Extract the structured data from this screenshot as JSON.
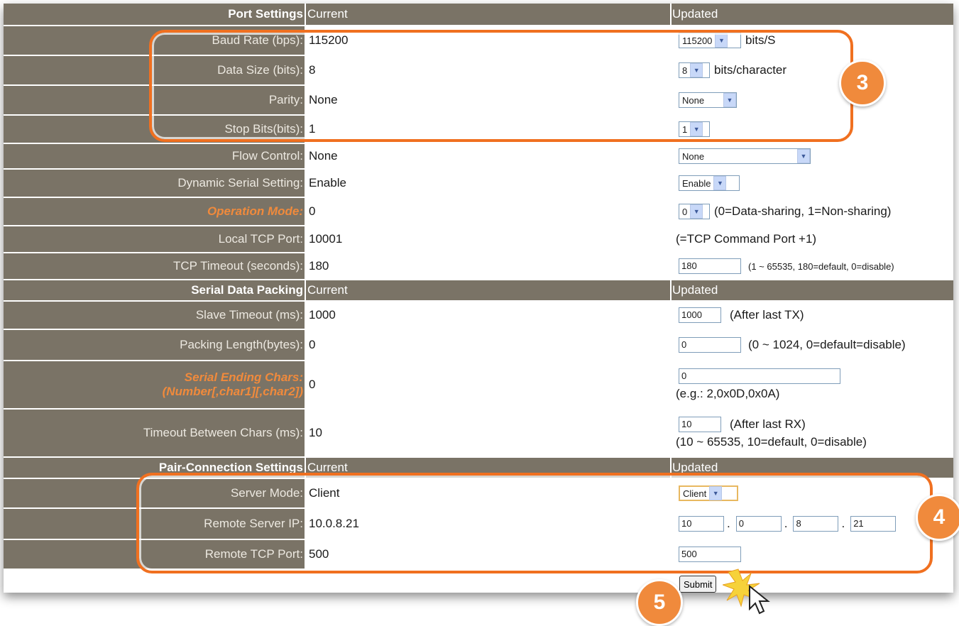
{
  "sections": {
    "port": {
      "title": "Port Settings",
      "current": "Current",
      "updated": "Updated"
    },
    "packing": {
      "title": "Serial Data Packing",
      "current": "Current",
      "updated": "Updated"
    },
    "pair": {
      "title": "Pair-Connection Settings",
      "current": "Current",
      "updated": "Updated"
    }
  },
  "rows": {
    "baud": {
      "label": "Baud Rate (bps):",
      "current": "115200",
      "select": "115200",
      "unit": "bits/S"
    },
    "datasize": {
      "label": "Data Size (bits):",
      "current": "8",
      "select": "8",
      "unit": "bits/character"
    },
    "parity": {
      "label": "Parity:",
      "current": "None",
      "select": "None"
    },
    "stopbits": {
      "label": "Stop Bits(bits):",
      "current": "1",
      "select": "1"
    },
    "flow": {
      "label": "Flow Control:",
      "current": "None",
      "select": "None"
    },
    "dynamic": {
      "label": "Dynamic Serial Setting:",
      "current": "Enable",
      "select": "Enable"
    },
    "opmode": {
      "label": "Operation Mode:",
      "current": "0",
      "select": "0",
      "note": "(0=Data-sharing, 1=Non-sharing)"
    },
    "localport": {
      "label": "Local TCP Port:",
      "current": "10001",
      "note": "(=TCP Command Port +1)"
    },
    "tcptimeout": {
      "label": "TCP Timeout (seconds):",
      "current": "180",
      "input": "180",
      "note": "(1 ~ 65535, 180=default, 0=disable)"
    },
    "slave": {
      "label": "Slave Timeout (ms):",
      "current": "1000",
      "input": "1000",
      "note": "(After last TX)"
    },
    "packlen": {
      "label": "Packing Length(bytes):",
      "current": "0",
      "input": "0",
      "note": "(0 ~ 1024, 0=default=disable)"
    },
    "ending": {
      "label1": "Serial Ending Chars:",
      "label2": "(Number[,char1][,char2])",
      "current": "0",
      "input": "0",
      "note": "(e.g.: 2,0x0D,0x0A)"
    },
    "between": {
      "label": "Timeout Between Chars (ms):",
      "current": "10",
      "input": "10",
      "note": "(After last RX)",
      "note2": "(10 ~ 65535, 10=default, 0=disable)"
    },
    "server": {
      "label": "Server Mode:",
      "current": "Client",
      "select": "Client"
    },
    "remoteip": {
      "label": "Remote Server IP:",
      "current": "10.0.8.21",
      "ip": [
        "10",
        "0",
        "8",
        "21"
      ],
      "dot": "."
    },
    "remoteport": {
      "label": "Remote TCP Port:",
      "current": "500",
      "input": "500"
    }
  },
  "submit_label": "Submit",
  "badges": {
    "b3": "3",
    "b4": "4",
    "b5": "5"
  },
  "colors": {
    "header": "#7a7366",
    "highlight": "#f07020",
    "badge": "#f08a3c",
    "orange_label": "#f08a3c"
  }
}
